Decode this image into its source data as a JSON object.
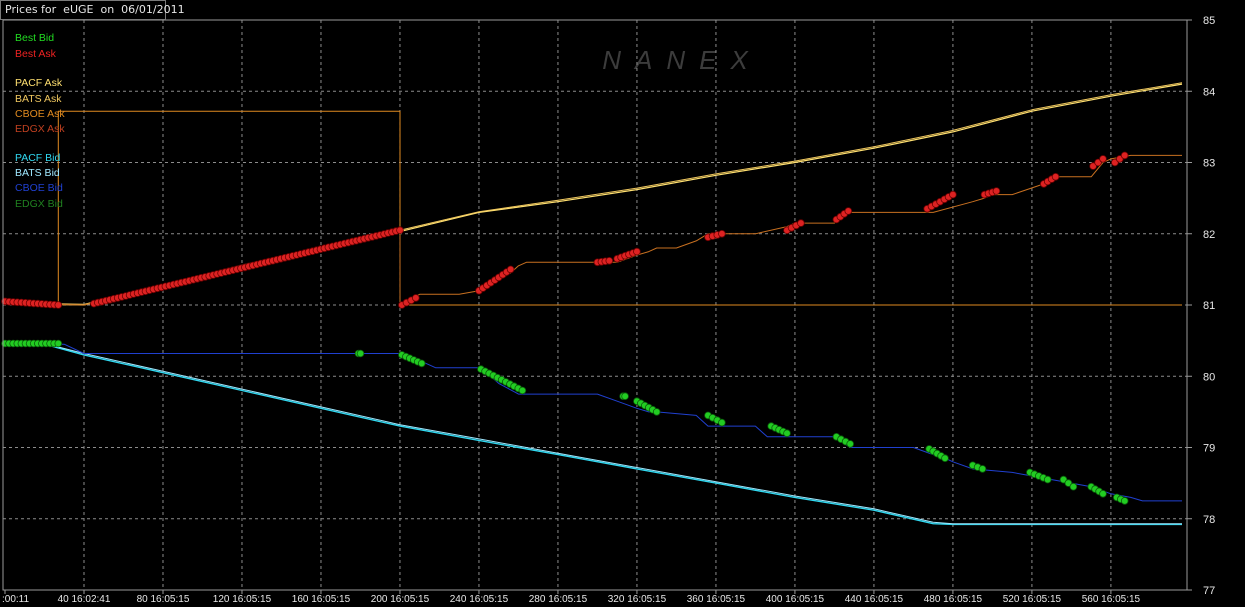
{
  "header": {
    "title": "Prices for  eUGE  on  06/01/2011"
  },
  "watermark": "NANEX",
  "colors": {
    "background": "#000000",
    "grid": "#8c8c8c",
    "frame": "#9a9a9a",
    "axis_text": "#e8e8e8",
    "best_bid": "#22dd22",
    "best_ask": "#ee2222",
    "pacf_ask": "#ffe070",
    "bats_ask": "#f0c860",
    "cboe_ask": "#e08a20",
    "edgx_ask": "#c04020",
    "pacf_bid": "#30d8f0",
    "bats_bid": "#a0e8ff",
    "cboe_bid": "#2040d0",
    "edgx_bid": "#208020"
  },
  "chart_data": {
    "type": "line",
    "title": "Prices for  eUGE  on  06/01/2011",
    "xlim": [
      0,
      596
    ],
    "ylim": [
      77,
      85
    ],
    "y_ticks": [
      "77",
      "78",
      "79",
      "80",
      "81",
      "82",
      "83",
      "84",
      "85"
    ],
    "x_tick_values": [
      0,
      40,
      80,
      120,
      160,
      200,
      240,
      280,
      320,
      360,
      400,
      440,
      480,
      520,
      560
    ],
    "x_tick_labels": [
      ":00:11",
      "40 16:02:41",
      "80 16:05:15",
      "120 16:05:15",
      "160 16:05:15",
      "200 16:05:15",
      "240 16:05:15",
      "280 16:05:15",
      "320 16:05:15",
      "360 16:05:15",
      "400 16:05:15",
      "440 16:05:15",
      "480 16:05:15",
      "520 16:05:15",
      "560 16:05:15"
    ],
    "grid": true,
    "legend_position": "top-left",
    "legend": [
      {
        "label": "Best Bid",
        "color": "#22dd22"
      },
      {
        "label": "Best Ask",
        "color": "#ee2222"
      },
      {
        "label": "PACF Ask",
        "color": "#ffe070"
      },
      {
        "label": "BATS Ask",
        "color": "#f0c860"
      },
      {
        "label": "CBOE Ask",
        "color": "#e08a20"
      },
      {
        "label": "EDGX Ask",
        "color": "#c04020"
      },
      {
        "label": "PACF Bid",
        "color": "#30d8f0"
      },
      {
        "label": "BATS Bid",
        "color": "#a0e8ff"
      },
      {
        "label": "CBOE Bid",
        "color": "#2040d0"
      },
      {
        "label": "EDGX Bid",
        "color": "#208020"
      }
    ],
    "series": [
      {
        "name": "PACF Ask",
        "color": "#ffe070",
        "width": 1.2,
        "x": [
          0,
          40,
          80,
          120,
          160,
          200,
          240,
          280,
          320,
          360,
          400,
          440,
          480,
          520,
          560,
          596
        ],
        "y": [
          81.02,
          81.0,
          81.27,
          81.55,
          81.78,
          82.03,
          82.3,
          82.45,
          82.62,
          82.82,
          83.0,
          83.2,
          83.43,
          83.72,
          83.93,
          84.1
        ]
      },
      {
        "name": "BATS Ask",
        "color": "#f0c860",
        "width": 1,
        "x": [
          0,
          40,
          80,
          120,
          160,
          200,
          240,
          280,
          320,
          360,
          400,
          440,
          480,
          520,
          560,
          596
        ],
        "y": [
          81.03,
          81.01,
          81.28,
          81.56,
          81.8,
          82.05,
          82.31,
          82.47,
          82.64,
          82.84,
          83.02,
          83.22,
          83.45,
          83.74,
          83.95,
          84.12
        ]
      },
      {
        "name": "CBOE Ask",
        "color": "#e08a20",
        "width": 1,
        "x": [
          0,
          27,
          27,
          200,
          200,
          596
        ],
        "y": [
          81.02,
          81.02,
          83.72,
          83.72,
          81.0,
          81.0
        ],
        "step": false
      },
      {
        "name": "Best Ask",
        "color": "#c87020",
        "width": 1,
        "x": [
          0,
          40,
          80,
          120,
          160,
          200,
          200,
          203,
          210,
          220,
          230,
          240,
          246,
          250,
          256,
          260,
          264,
          300,
          310,
          320,
          326,
          330,
          340,
          350,
          356,
          360,
          380,
          396,
          400,
          420,
          426,
          440,
          460,
          470,
          490,
          496,
          500,
          510,
          526,
          530,
          540,
          550,
          556,
          560,
          570,
          580,
          596
        ],
        "y": [
          81.02,
          81.0,
          81.27,
          81.55,
          81.78,
          82.03,
          81.0,
          81.05,
          81.15,
          81.15,
          81.15,
          81.2,
          81.3,
          81.35,
          81.45,
          81.55,
          81.6,
          81.6,
          81.6,
          81.7,
          81.75,
          81.8,
          81.8,
          81.9,
          82.0,
          82.0,
          82.0,
          82.1,
          82.15,
          82.15,
          82.3,
          82.3,
          82.3,
          82.3,
          82.45,
          82.5,
          82.55,
          82.55,
          82.7,
          82.8,
          82.8,
          82.8,
          83.0,
          83.05,
          83.1,
          83.1,
          83.1
        ]
      },
      {
        "name": "PACF Bid",
        "color": "#30d8f0",
        "width": 1.4,
        "x": [
          0,
          20,
          40,
          80,
          120,
          160,
          200,
          240,
          280,
          320,
          360,
          400,
          440,
          470,
          480,
          596
        ],
        "y": [
          80.45,
          80.45,
          80.3,
          80.05,
          79.8,
          79.55,
          79.3,
          79.1,
          78.9,
          78.7,
          78.5,
          78.3,
          78.12,
          77.93,
          77.92,
          77.92
        ]
      },
      {
        "name": "BATS Bid",
        "color": "#a0e8ff",
        "width": 1,
        "x": [
          0,
          20,
          40,
          80,
          120,
          160,
          200,
          240,
          280,
          320,
          360,
          400,
          440,
          470,
          480,
          596
        ],
        "y": [
          80.46,
          80.46,
          80.32,
          80.07,
          79.82,
          79.57,
          79.32,
          79.12,
          78.92,
          78.72,
          78.52,
          78.32,
          78.14,
          77.95,
          77.93,
          77.93
        ]
      },
      {
        "name": "Best Bid",
        "color": "#2040d0",
        "width": 1,
        "x": [
          0,
          20,
          30,
          40,
          180,
          200,
          210,
          218,
          230,
          240,
          246,
          250,
          260,
          266,
          270,
          300,
          310,
          320,
          326,
          330,
          350,
          356,
          360,
          380,
          386,
          400,
          420,
          428,
          440,
          460,
          470,
          476,
          480,
          490,
          510,
          520,
          530,
          540,
          550,
          560,
          570,
          576,
          596
        ],
        "y": [
          80.45,
          80.45,
          80.45,
          80.32,
          80.32,
          80.32,
          80.22,
          80.12,
          80.12,
          80.12,
          80.0,
          79.9,
          79.75,
          79.75,
          79.75,
          79.75,
          79.65,
          79.55,
          79.5,
          79.5,
          79.45,
          79.3,
          79.3,
          79.3,
          79.15,
          79.15,
          79.15,
          79.0,
          79.0,
          79.0,
          78.9,
          78.85,
          78.8,
          78.7,
          78.65,
          78.6,
          78.55,
          78.5,
          78.45,
          78.35,
          78.3,
          78.25,
          78.25
        ]
      }
    ],
    "dots": {
      "ask_color": "#dd2222",
      "bid_color": "#22cc22",
      "ask_segments": [
        [
          0,
          27,
          81.05,
          81.0
        ],
        [
          45,
          200,
          81.02,
          82.05
        ],
        [
          201,
          208,
          81.0,
          81.1
        ],
        [
          240,
          256,
          81.2,
          81.5
        ],
        [
          300,
          306,
          81.6,
          81.62
        ],
        [
          310,
          320,
          81.65,
          81.75
        ],
        [
          356,
          363,
          81.95,
          82.0
        ],
        [
          396,
          403,
          82.05,
          82.15
        ],
        [
          421,
          427,
          82.2,
          82.32
        ],
        [
          467,
          480,
          82.35,
          82.55
        ],
        [
          496,
          502,
          82.55,
          82.6
        ],
        [
          526,
          532,
          82.7,
          82.8
        ],
        [
          551,
          556,
          82.95,
          83.05
        ],
        [
          562,
          567,
          83.0,
          83.1
        ]
      ],
      "bid_segments": [
        [
          0,
          27,
          80.46,
          80.46
        ],
        [
          179,
          180,
          80.32,
          80.32
        ],
        [
          201,
          211,
          80.3,
          80.18
        ],
        [
          241,
          262,
          80.1,
          79.8
        ],
        [
          313,
          314,
          79.72,
          79.72
        ],
        [
          320,
          330,
          79.65,
          79.5
        ],
        [
          356,
          363,
          79.45,
          79.35
        ],
        [
          388,
          396,
          79.3,
          79.2
        ],
        [
          421,
          428,
          79.15,
          79.05
        ],
        [
          468,
          476,
          78.98,
          78.85
        ],
        [
          490,
          495,
          78.75,
          78.7
        ],
        [
          519,
          528,
          78.65,
          78.55
        ],
        [
          536,
          541,
          78.55,
          78.45
        ],
        [
          550,
          556,
          78.45,
          78.35
        ],
        [
          563,
          567,
          78.3,
          78.25
        ]
      ]
    }
  }
}
